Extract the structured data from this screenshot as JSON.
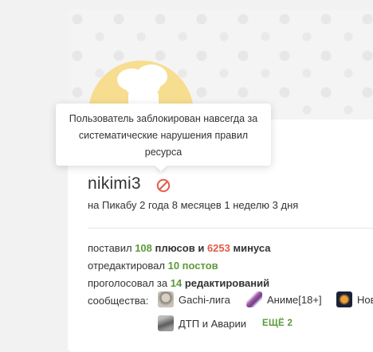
{
  "tooltip": {
    "text": "Пользователь заблокирован навсегда за систематические нарушения правил ресурса"
  },
  "profile": {
    "username": "nikimi3",
    "tenure": "на Пикабу 2 года 8 месяцев 1 неделю 3 дня"
  },
  "stats": {
    "line1": {
      "prefix": "поставил ",
      "pluses": "108",
      "mid": " плюсов",
      "and": " и ",
      "minuses": "6253",
      "suffix": " минуса"
    },
    "line2": {
      "prefix": "отредактировал ",
      "value": "10 постов"
    },
    "line3": {
      "prefix": "проголосовал за ",
      "count": "14",
      "suffix": " редактирований"
    }
  },
  "communities": {
    "label": "сообщества:",
    "items": [
      {
        "name": "Gachi-лига",
        "icon": "gachi-avatar-icon"
      },
      {
        "name": "Аниме[18+]",
        "icon": "anime-avatar-icon"
      },
      {
        "name": "Нов",
        "icon": "space-avatar-icon"
      },
      {
        "name": "ДТП и Аварии",
        "icon": "crash-avatar-icon"
      }
    ],
    "more": "ЕЩЁ 2"
  },
  "colors": {
    "accent_green": "#5b9b3a",
    "minus_red": "#e45b4a",
    "ban_red": "#e45b4a",
    "avatar_yellow": "#f7dd8f"
  }
}
